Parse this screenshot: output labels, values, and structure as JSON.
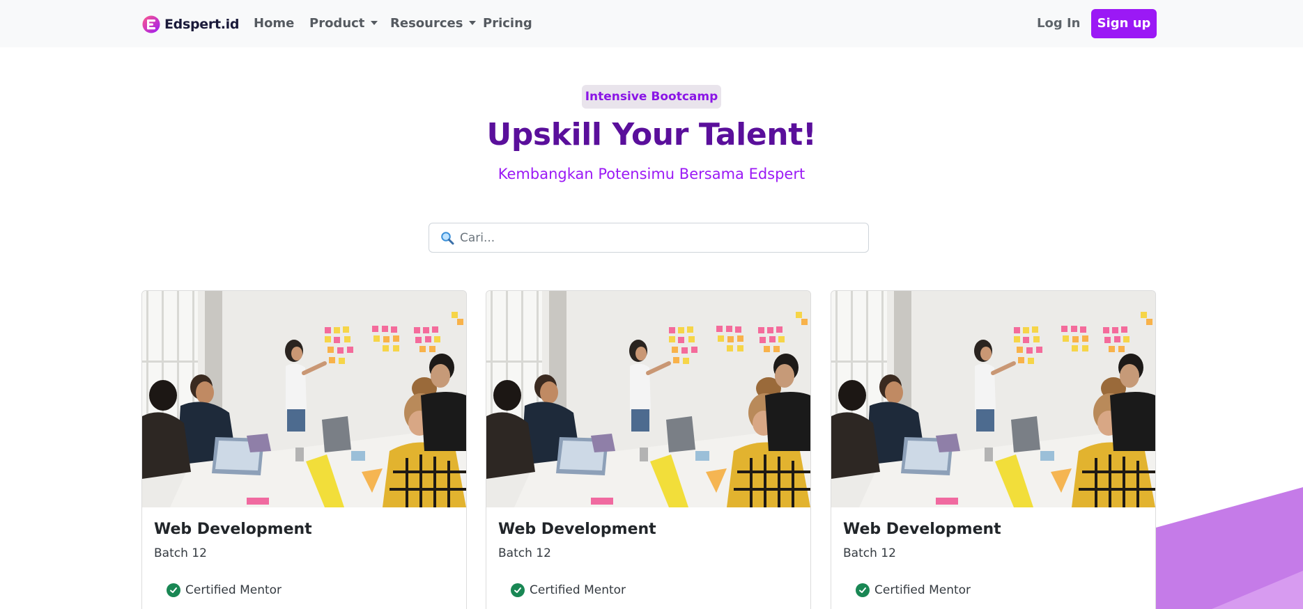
{
  "nav": {
    "brand": "Edspert.id",
    "items": [
      {
        "label": "Home",
        "dropdown": false
      },
      {
        "label": "Product",
        "dropdown": true
      },
      {
        "label": "Resources",
        "dropdown": true
      },
      {
        "label": "Pricing",
        "dropdown": false
      }
    ],
    "login": "Log In",
    "signup": "Sign up"
  },
  "hero": {
    "badge": "Intensive Bootcamp",
    "title": "Upskill Your Talent!",
    "subtitle": "Kembangkan Potensimu Bersama Edspert"
  },
  "search": {
    "placeholder": "Cari...",
    "value": ""
  },
  "cards": [
    {
      "title": "Web Development",
      "batch": "Batch 12",
      "feature": "Certified Mentor"
    },
    {
      "title": "Web Development",
      "batch": "Batch 12",
      "feature": "Certified Mentor"
    },
    {
      "title": "Web Development",
      "batch": "Batch 12",
      "feature": "Certified Mentor"
    }
  ],
  "colors": {
    "accent": "#9b19f5",
    "title": "#5a0f9b",
    "navbar_bg": "#f8f9fa",
    "check": "#198754"
  },
  "icons": [
    "brand-logo-icon",
    "search-icon",
    "check-circle-icon",
    "chevron-down-icon"
  ]
}
